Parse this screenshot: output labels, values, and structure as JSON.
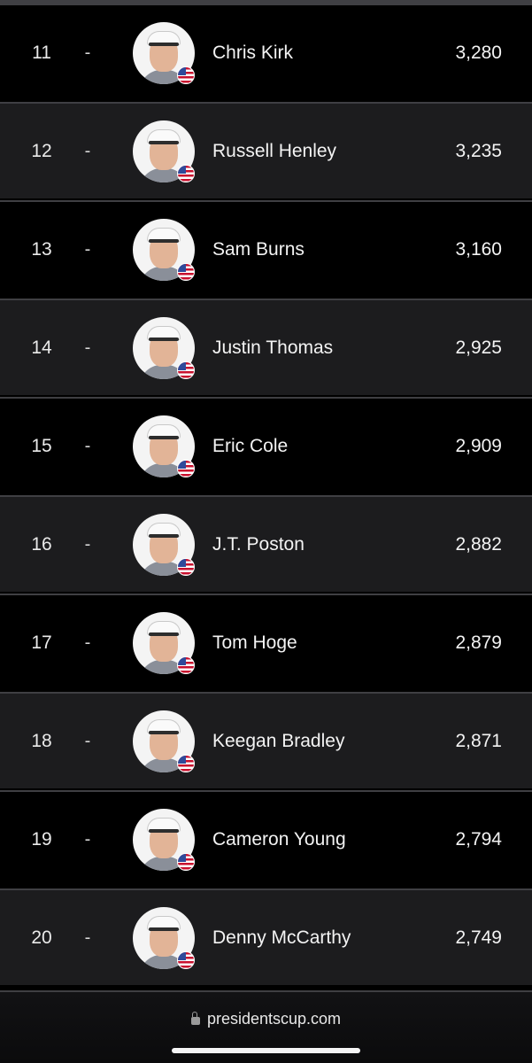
{
  "standings": [
    {
      "rank": "11",
      "movement": "-",
      "name": "Chris Kirk",
      "points": "3,280",
      "flag_colors": [
        "#c8102e",
        "#ffffff",
        "#2f4a9a"
      ]
    },
    {
      "rank": "12",
      "movement": "-",
      "name": "Russell Henley",
      "points": "3,235",
      "flag_colors": [
        "#c8102e",
        "#ffffff",
        "#2f4a9a"
      ]
    },
    {
      "rank": "13",
      "movement": "-",
      "name": "Sam Burns",
      "points": "3,160",
      "flag_colors": [
        "#c8102e",
        "#ffffff",
        "#2f4a9a"
      ]
    },
    {
      "rank": "14",
      "movement": "-",
      "name": "Justin Thomas",
      "points": "2,925",
      "flag_colors": [
        "#c8102e",
        "#ffffff",
        "#2f4a9a"
      ]
    },
    {
      "rank": "15",
      "movement": "-",
      "name": "Eric Cole",
      "points": "2,909",
      "flag_colors": [
        "#c8102e",
        "#ffffff",
        "#2f4a9a"
      ]
    },
    {
      "rank": "16",
      "movement": "-",
      "name": "J.T. Poston",
      "points": "2,882",
      "flag_colors": [
        "#c8102e",
        "#ffffff",
        "#2f4a9a"
      ]
    },
    {
      "rank": "17",
      "movement": "-",
      "name": "Tom Hoge",
      "points": "2,879",
      "flag_colors": [
        "#c8102e",
        "#ffffff",
        "#2f4a9a"
      ]
    },
    {
      "rank": "18",
      "movement": "-",
      "name": "Keegan Bradley",
      "points": "2,871",
      "flag_colors": [
        "#c8102e",
        "#ffffff",
        "#2f4a9a"
      ]
    },
    {
      "rank": "19",
      "movement": "-",
      "name": "Cameron Young",
      "points": "2,794",
      "flag_colors": [
        "#c8102e",
        "#ffffff",
        "#2f4a9a"
      ]
    },
    {
      "rank": "20",
      "movement": "-",
      "name": "Denny McCarthy",
      "points": "2,749",
      "flag_colors": [
        "#c8102e",
        "#ffffff",
        "#2f4a9a"
      ]
    }
  ],
  "browser": {
    "url": "presidentscup.com",
    "lock_icon": "lock-icon"
  },
  "colors": {
    "row_dark": "#000000",
    "row_light": "#1c1c1e",
    "divider": "#3f3f43",
    "text": "#f3f3f3"
  }
}
